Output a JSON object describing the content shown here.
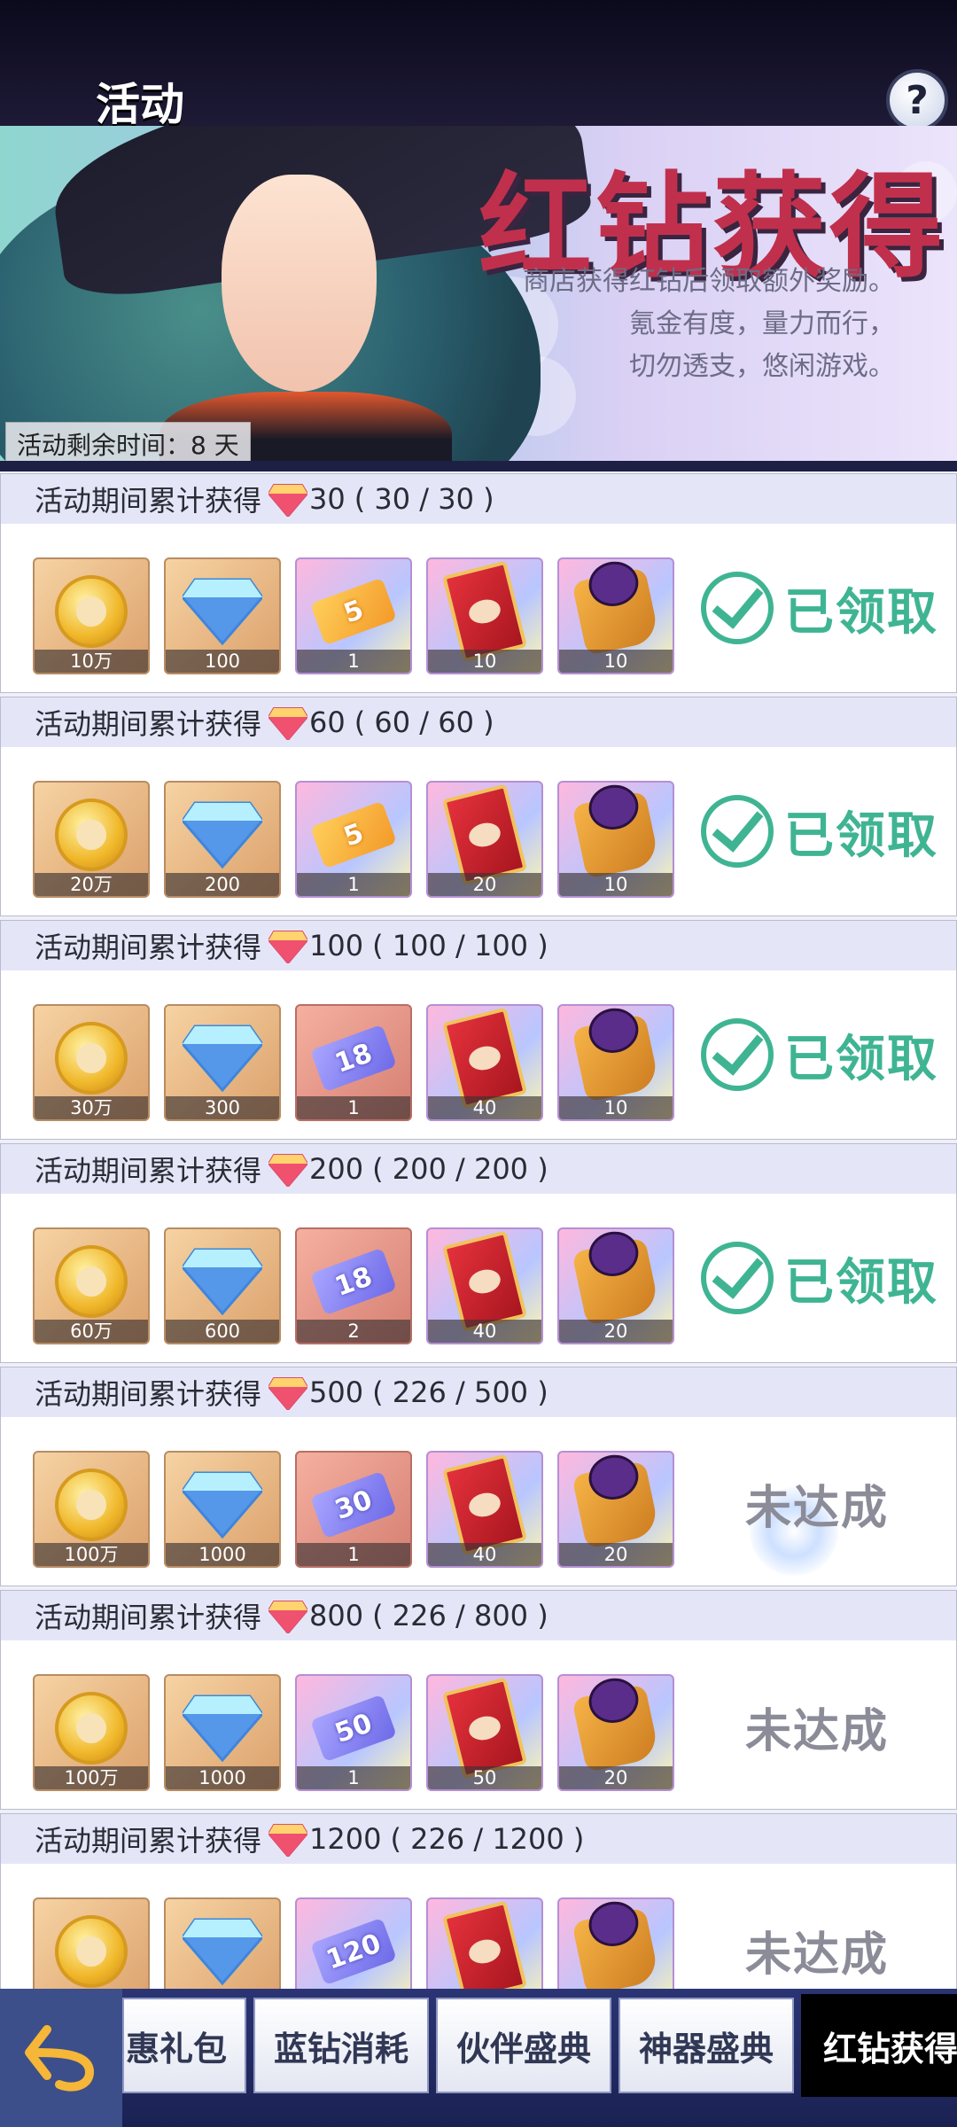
{
  "header": {
    "title": "活动",
    "help_icon": "?"
  },
  "banner": {
    "title": "红钻获得",
    "description": [
      "商店获得红钻后领取额外奖励。",
      "氪金有度，量力而行，",
      "切勿透支，悠闲游戏。"
    ],
    "remaining_time": "活动剩余时间：8 天"
  },
  "milestones": [
    {
      "label": "活动期间累计获得",
      "target": "30",
      "progress": "( 30 / 30 )",
      "status": "已领取",
      "claimed": true,
      "rewards": [
        {
          "type": "coin",
          "qty": "10万"
        },
        {
          "type": "diamond",
          "qty": "100"
        },
        {
          "type": "ticket-gold",
          "art": "5",
          "qty": "1"
        },
        {
          "type": "card",
          "qty": "10"
        },
        {
          "type": "puzzle",
          "qty": "10"
        }
      ]
    },
    {
      "label": "活动期间累计获得",
      "target": "60",
      "progress": "( 60 / 60 )",
      "status": "已领取",
      "claimed": true,
      "rewards": [
        {
          "type": "coin",
          "qty": "20万"
        },
        {
          "type": "diamond",
          "qty": "200"
        },
        {
          "type": "ticket-gold",
          "art": "5",
          "qty": "1"
        },
        {
          "type": "card",
          "qty": "20"
        },
        {
          "type": "puzzle",
          "qty": "10"
        }
      ]
    },
    {
      "label": "活动期间累计获得",
      "target": "100",
      "progress": "( 100 / 100 )",
      "status": "已领取",
      "claimed": true,
      "rewards": [
        {
          "type": "coin",
          "qty": "30万"
        },
        {
          "type": "diamond",
          "qty": "300"
        },
        {
          "type": "ticket-purple",
          "art": "18",
          "qty": "1"
        },
        {
          "type": "card",
          "qty": "40"
        },
        {
          "type": "puzzle",
          "qty": "10"
        }
      ]
    },
    {
      "label": "活动期间累计获得",
      "target": "200",
      "progress": "( 200 / 200 )",
      "status": "已领取",
      "claimed": true,
      "rewards": [
        {
          "type": "coin",
          "qty": "60万"
        },
        {
          "type": "diamond",
          "qty": "600"
        },
        {
          "type": "ticket-purple",
          "art": "18",
          "qty": "2"
        },
        {
          "type": "card",
          "qty": "40"
        },
        {
          "type": "puzzle",
          "qty": "20"
        }
      ]
    },
    {
      "label": "活动期间累计获得",
      "target": "500",
      "progress": "( 226 / 500 )",
      "status": "未达成",
      "claimed": false,
      "rewards": [
        {
          "type": "coin",
          "qty": "100万"
        },
        {
          "type": "diamond",
          "qty": "1000"
        },
        {
          "type": "ticket-purple",
          "art": "30",
          "qty": "1"
        },
        {
          "type": "card",
          "qty": "40"
        },
        {
          "type": "puzzle",
          "qty": "20"
        }
      ]
    },
    {
      "label": "活动期间累计获得",
      "target": "800",
      "progress": "( 226 / 800 )",
      "status": "未达成",
      "claimed": false,
      "rewards": [
        {
          "type": "coin",
          "qty": "100万"
        },
        {
          "type": "diamond",
          "qty": "1000"
        },
        {
          "type": "ticket-purple",
          "art": "50",
          "qty": "1"
        },
        {
          "type": "card",
          "qty": "50"
        },
        {
          "type": "puzzle",
          "qty": "20"
        }
      ]
    },
    {
      "label": "活动期间累计获得",
      "target": "1200",
      "progress": "( 226 / 1200 )",
      "status": "未达成",
      "claimed": false,
      "rewards": [
        {
          "type": "coin",
          "qty": ""
        },
        {
          "type": "diamond",
          "qty": ""
        },
        {
          "type": "ticket-purple",
          "art": "120",
          "qty": ""
        },
        {
          "type": "card",
          "qty": ""
        },
        {
          "type": "puzzle",
          "qty": ""
        }
      ]
    }
  ],
  "bottom_nav": {
    "back_icon": "back-arrow-icon",
    "tabs": [
      {
        "label": "惠礼包",
        "active": false
      },
      {
        "label": "蓝钻消耗",
        "active": false
      },
      {
        "label": "伙伴盛典",
        "active": false
      },
      {
        "label": "神器盛典",
        "active": false
      },
      {
        "label": "红钻获得",
        "active": true
      }
    ]
  },
  "colors": {
    "claimed": "#3fb493",
    "unmet": "#8b8c98",
    "banner_title": "#c0304c",
    "nav": "#1a2152"
  }
}
